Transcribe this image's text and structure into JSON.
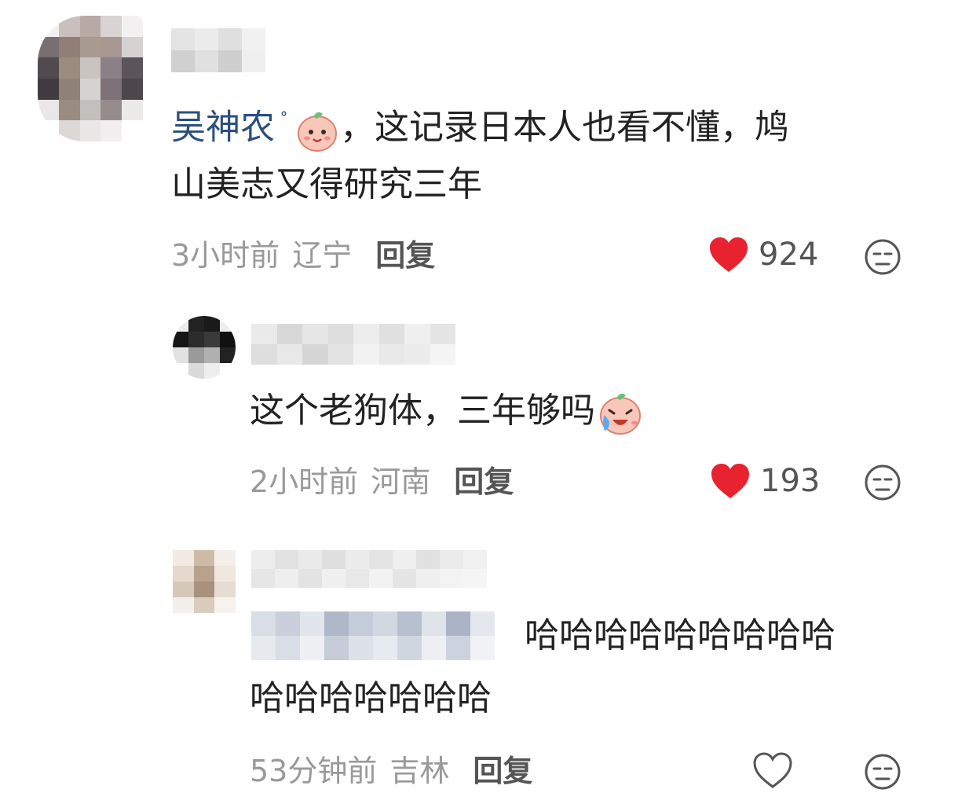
{
  "comments": [
    {
      "mention": "吴神农",
      "text_line1": "，这记录日本人也看不懂，鸠",
      "text_line2": "山美志又得研究三年",
      "time": "3小时前",
      "location": "辽宁",
      "reply_label": "回复",
      "likes": "924",
      "liked": true
    },
    {
      "text_line1": "这个老狗体，三年够吗",
      "time": "2小时前",
      "location": "河南",
      "reply_label": "回复",
      "likes": "193",
      "liked": true
    },
    {
      "text_line1": "哈哈哈哈哈哈哈哈哈",
      "text_line2": "哈哈哈哈哈哈哈",
      "time": "53分钟前",
      "location": "吉林",
      "reply_label": "回复",
      "liked": false
    }
  ],
  "icons": {
    "heart": "heart-icon",
    "dislike": "dislike-face-icon",
    "smile_emoji": "smile-emoji",
    "cry_emoji": "cry-laugh-emoji"
  },
  "colors": {
    "heart_red": "#e8222e",
    "mention_blue": "#2b4f7e",
    "meta_gray": "#999999"
  }
}
